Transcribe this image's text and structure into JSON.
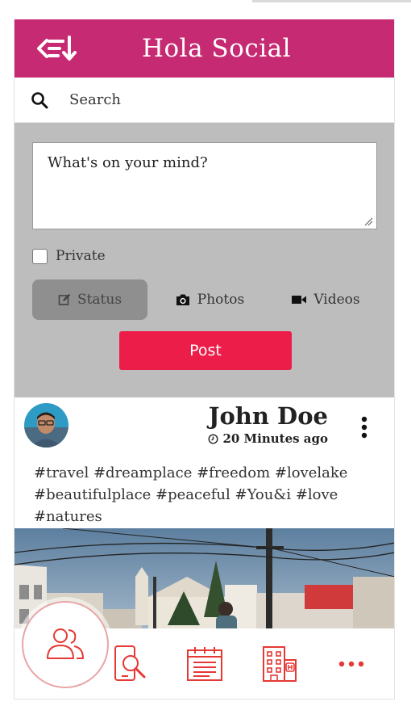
{
  "header": {
    "title": "Hola Social",
    "menu_icon": "menu-sort-icon",
    "color": "#c52a72"
  },
  "search": {
    "label": "Search",
    "icon": "search-icon"
  },
  "composer": {
    "placeholder": "What's on your mind?",
    "private_label": "Private",
    "private_checked": false,
    "tabs": [
      {
        "label": "Status",
        "icon": "edit-icon",
        "active": true
      },
      {
        "label": "Photos",
        "icon": "camera-icon",
        "active": false
      },
      {
        "label": "Videos",
        "icon": "video-icon",
        "active": false
      }
    ],
    "post_label": "Post",
    "post_color": "#ec1e49"
  },
  "post": {
    "author": "John Doe",
    "time": "20 Minutes ago",
    "hashtags": "#travel #dreamplace #freedom #lovelake #beautifulplace #peaceful #You&i #love #natures"
  },
  "bottom_nav": {
    "items": [
      {
        "name": "friends",
        "icon": "people-icon"
      },
      {
        "name": "search-people",
        "icon": "phone-search-icon"
      },
      {
        "name": "calendar",
        "icon": "calendar-icon"
      },
      {
        "name": "places",
        "icon": "building-icon"
      },
      {
        "name": "more",
        "icon": "more-dots-icon"
      }
    ],
    "accent": "#e53935"
  }
}
